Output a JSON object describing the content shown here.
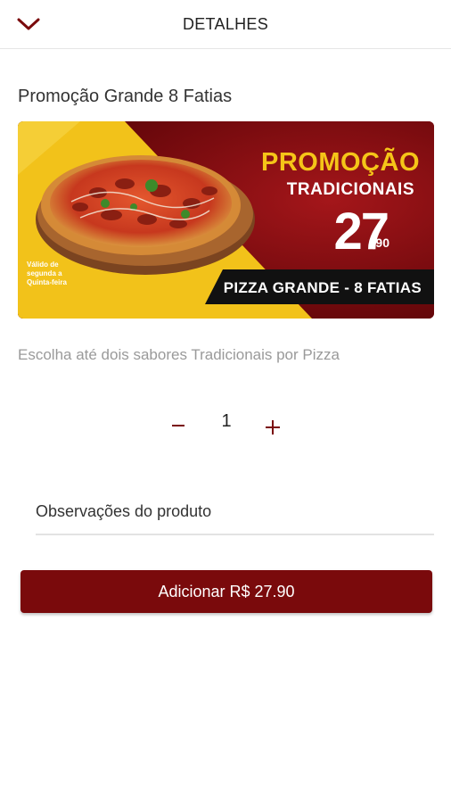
{
  "header": {
    "title": "DETALHES",
    "back_icon": "chevron-down-icon"
  },
  "product": {
    "title": "Promoção Grande 8 Fatias",
    "description": "Escolha até dois sabores Tradicionais por Pizza"
  },
  "banner": {
    "promo_label": "PROMOÇÃO",
    "category_label": "TRADICIONAIS",
    "price_int": "27",
    "price_dec": ",90",
    "strip_label": "PIZZA GRANDE - 8 FATIAS",
    "small_note": "Válido de segunda a Quinta-feira"
  },
  "quantity": {
    "value": "1",
    "minus_symbol": "−",
    "plus_symbol": "+"
  },
  "observations": {
    "placeholder": "Observações do produto"
  },
  "actions": {
    "add_label": "Adicionar R$ 27.90"
  },
  "colors": {
    "accent": "#7a0a0c",
    "promo_yellow": "#f5c518"
  }
}
